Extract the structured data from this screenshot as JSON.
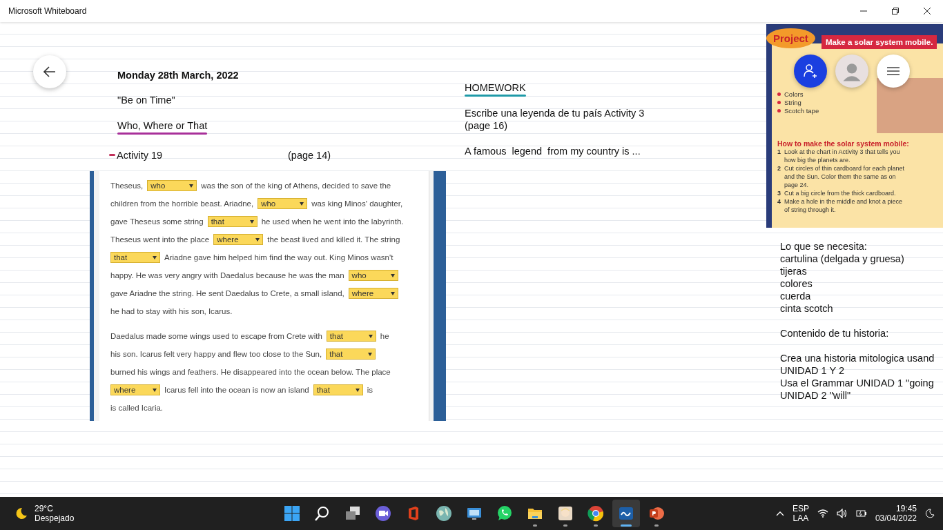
{
  "window": {
    "title": "Microsoft Whiteboard"
  },
  "notes": [
    {
      "kind": "heading",
      "text": "Monday 28th March, 2022"
    },
    {
      "kind": "plain",
      "text": "\"Be on Time\""
    },
    {
      "kind": "underlined",
      "text": "Who, Where or That",
      "color": "#a8309a"
    }
  ],
  "activity": {
    "label": "Activity 19",
    "page": "(page 14)"
  },
  "homework": {
    "title": "HOMEWORK",
    "lines": [
      "Escribe una leyenda de tu país Activity 3",
      "(page 16)"
    ],
    "prompt": "A famous  legend  from my country is ..."
  },
  "worksheet": {
    "paragraphs": [
      [
        [
          {
            "kind": "text",
            "text": "Theseus,"
          },
          {
            "kind": "select",
            "value": "who"
          },
          {
            "kind": "text",
            "text": "was the son of the king of Athens, decided to save the"
          }
        ],
        [
          {
            "kind": "text",
            "text": "children from the horrible beast. Ariadne,"
          },
          {
            "kind": "select",
            "value": "who"
          },
          {
            "kind": "text",
            "text": "was king Minos' daughter,"
          }
        ],
        [
          {
            "kind": "text",
            "text": "gave Theseus some string"
          },
          {
            "kind": "select",
            "value": "that"
          },
          {
            "kind": "text",
            "text": "he used when he went into the labyrinth."
          }
        ],
        [
          {
            "kind": "text",
            "text": "Theseus went into the place"
          },
          {
            "kind": "select",
            "value": "where"
          },
          {
            "kind": "text",
            "text": "the beast lived and killed it. The string"
          }
        ],
        [
          {
            "kind": "select",
            "value": "that"
          },
          {
            "kind": "text",
            "text": "Ariadne gave him helped him find the way out. King Minos wasn't"
          }
        ],
        [
          {
            "kind": "text",
            "text": "happy. He was very angry with Daedalus because he was the man"
          },
          {
            "kind": "select",
            "value": "who"
          }
        ],
        [
          {
            "kind": "text",
            "text": "gave Ariadne the string. He sent Daedalus to Crete, a small island,"
          },
          {
            "kind": "select",
            "value": "where"
          }
        ],
        [
          {
            "kind": "text",
            "text": "he had to stay with his son, Icarus."
          }
        ]
      ],
      [
        [
          {
            "kind": "text",
            "text": "Daedalus made some wings used to escape from Crete with"
          },
          {
            "kind": "select",
            "value": "that"
          },
          {
            "kind": "text",
            "text": "he"
          }
        ],
        [
          {
            "kind": "text",
            "text": "his son. Icarus felt very happy and flew too close to the Sun,"
          },
          {
            "kind": "select",
            "value": "that"
          }
        ],
        [
          {
            "kind": "text",
            "text": "burned his wings and feathers. He disappeared into the ocean below. The place"
          }
        ],
        [
          {
            "kind": "select",
            "value": "where"
          },
          {
            "kind": "text",
            "text": "Icarus fell into the ocean is now an island"
          },
          {
            "kind": "select",
            "value": "that"
          },
          {
            "kind": "text",
            "text": "is"
          }
        ],
        [
          {
            "kind": "text",
            "text": "is called Icaria."
          }
        ]
      ]
    ]
  },
  "project": {
    "badge": "Project",
    "title": "Make a solar system mobile.",
    "materials": [
      "Colors",
      "String",
      "Scotch tape"
    ],
    "howto_title": "How to make the solar system mobile:",
    "steps": [
      {
        "number": "1",
        "text": "Look at the chart in Activity 3 that tells you how big the planets are."
      },
      {
        "number": "2",
        "text": "Cut circles of thin cardboard for each planet and the Sun. Color them the same as on page 24."
      },
      {
        "number": "3",
        "text": "Cut a big circle from the thick cardboard."
      },
      {
        "number": "4",
        "text": "Make a hole in the middle and knot a piece of string through it."
      }
    ]
  },
  "right_notes": [
    {
      "lines": [
        "Lo que se necesita:",
        "cartulina (delgada y gruesa)",
        "tijeras",
        "colores",
        "cuerda",
        "cinta scotch"
      ]
    },
    {
      "lines": [
        "Contenido de tu historia:"
      ]
    },
    {
      "lines": [
        "Crea una historia mitologica usand",
        "UNIDAD 1 Y 2",
        "Usa el Grammar UNIDAD 1 \"going",
        "UNIDAD 2 \"will\""
      ]
    }
  ],
  "taskbar": {
    "weather": {
      "temp": "29°C",
      "condition": "Despejado"
    },
    "apps": [
      {
        "kind": "start",
        "running": false,
        "active": false
      },
      {
        "kind": "search",
        "running": false,
        "active": false
      },
      {
        "kind": "taskview",
        "running": false,
        "active": false
      },
      {
        "kind": "chat",
        "running": false,
        "active": false
      },
      {
        "kind": "office",
        "running": false,
        "active": false
      },
      {
        "kind": "globe",
        "running": false,
        "active": false
      },
      {
        "kind": "monitor",
        "running": false,
        "active": false
      },
      {
        "kind": "whatsapp",
        "running": false,
        "active": false
      },
      {
        "kind": "folder",
        "running": true,
        "active": false
      },
      {
        "kind": "avatar",
        "running": true,
        "active": false
      },
      {
        "kind": "chrome",
        "running": true,
        "active": false
      },
      {
        "kind": "whiteboard",
        "running": true,
        "active": true
      },
      {
        "kind": "powerpoint",
        "running": true,
        "active": false
      }
    ],
    "language": [
      "ESP",
      "LAA"
    ],
    "time": "19:45",
    "date": "03/04/2022"
  }
}
